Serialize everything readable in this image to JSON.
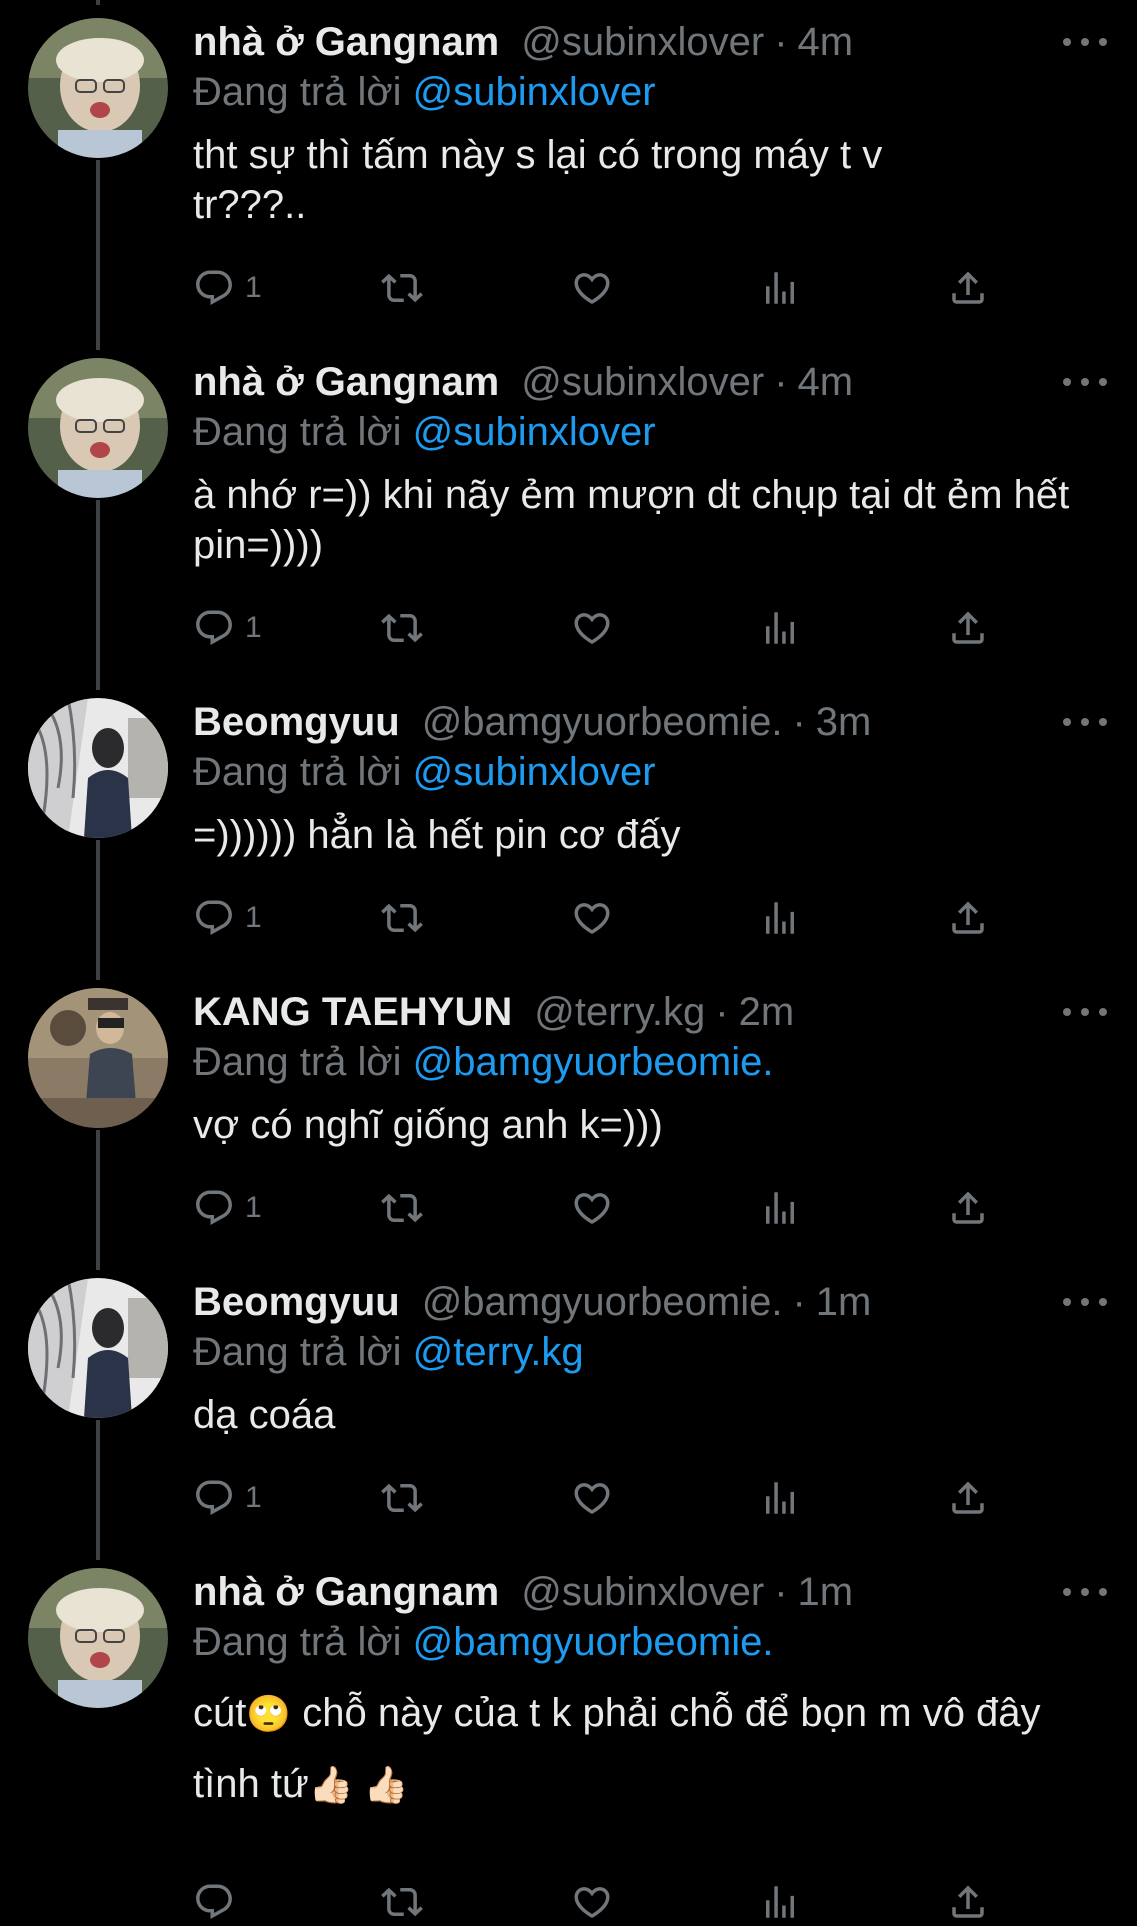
{
  "tweets": [
    {
      "name": "nhà ở Gangnam",
      "handle": "@subinxlover",
      "dot": "·",
      "time": "4m",
      "replying_label": "Đang trả lời",
      "replying_to": "@subinxlover",
      "text": "tht sự thì tấm này s lại có trong máy t v tr???..",
      "reply_count": "1",
      "avatar_style": "blond-man"
    },
    {
      "name": "nhà ở Gangnam",
      "handle": "@subinxlover",
      "dot": "·",
      "time": "4m",
      "replying_label": "Đang trả lời",
      "replying_to": "@subinxlover",
      "text": "à nhớ r=)) khi nãy ẻm mượn dt chụp tại dt ẻm hết pin=))))",
      "reply_count": "1",
      "avatar_style": "blond-man"
    },
    {
      "name": "Beomgyuu",
      "handle": "@bamgyuorbeomie.",
      "dot": "·",
      "time": "3m",
      "replying_label": "Đang trả lời",
      "replying_to": "@subinxlover",
      "text": "=)))))) hẳn là hết pin cơ đấy",
      "reply_count": "1",
      "avatar_style": "tree-profile"
    },
    {
      "name": "KANG TAEHYUN",
      "handle": "@terry.kg",
      "dot": "·",
      "time": "2m",
      "replying_label": "Đang trả lời",
      "replying_to": "@bamgyuorbeomie.",
      "text": "vợ có nghĩ giống anh k=)))",
      "reply_count": "1",
      "avatar_style": "mirror-selfie"
    },
    {
      "name": "Beomgyuu",
      "handle": "@bamgyuorbeomie.",
      "dot": "·",
      "time": "1m",
      "replying_label": "Đang trả lời",
      "replying_to": "@terry.kg",
      "text": "dạ coáa",
      "reply_count": "1",
      "avatar_style": "tree-profile"
    },
    {
      "name": "nhà ở Gangnam",
      "handle": "@subinxlover",
      "dot": "·",
      "time": "1m",
      "replying_label": "Đang trả lời",
      "replying_to": "@bamgyuorbeomie.",
      "text_part1": "cút",
      "emoji1": "🙄",
      "text_part2": " chỗ này của t k phải chỗ để bọn m vô đây tình tứ",
      "emoji2": "👍🏻 👍🏻",
      "reply_count": "",
      "avatar_style": "blond-man"
    }
  ],
  "icons": {
    "reply": "reply-icon",
    "retweet": "retweet-icon",
    "like": "heart-icon",
    "views": "views-icon",
    "share": "share-icon",
    "more": "more-icon"
  },
  "colors": {
    "background": "#000000",
    "text": "#e7e9ea",
    "muted": "#71767b",
    "link": "#1d9bf0"
  }
}
